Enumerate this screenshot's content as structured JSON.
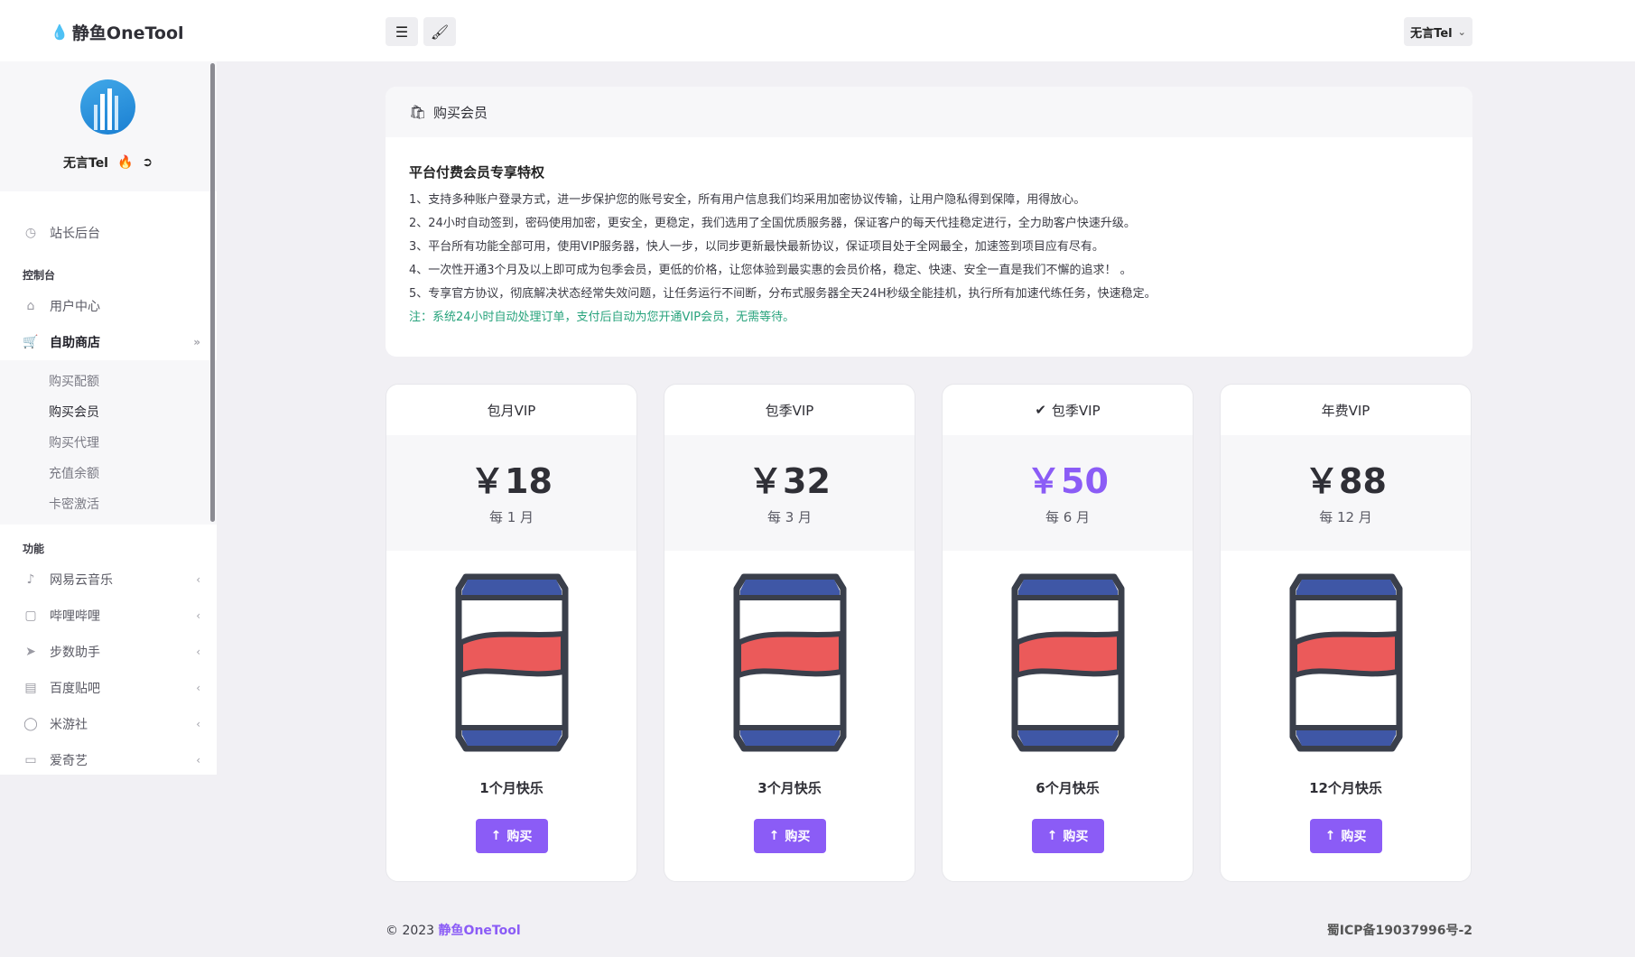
{
  "header": {
    "brand": "静鱼OneTool",
    "user_menu": "无言Tel",
    "menu_icon": "hamburger-icon",
    "theme_icon": "brush-icon"
  },
  "sidebar": {
    "profile_name": "无言Tel",
    "dashboard": "站长后台",
    "section_console": "控制台",
    "user_center": "用户中心",
    "shop": "自助商店",
    "shop_items": [
      "购买配额",
      "购买会员",
      "购买代理",
      "充值余额",
      "卡密激活"
    ],
    "section_functions": "功能",
    "functions": [
      "网易云音乐",
      "哔哩哔哩",
      "步数助手",
      "百度贴吧",
      "米游社",
      "爱奇艺"
    ]
  },
  "main": {
    "card_title": "购买会员",
    "privileges_title": "平台付费会员专享特权",
    "privileges": [
      "1、支持多种账户登录方式，进一步保护您的账号安全，所有用户信息我们均采用加密协议传输，让用户隐私得到保障，用得放心。",
      "2、24小时自动签到，密码使用加密，更安全，更稳定，我们选用了全国优质服务器，保证客户的每天代挂稳定进行，全力助客户快速升级。",
      "3、平台所有功能全部可用，使用VIP服务器，快人一步，以同步更新最快最新协议，保证项目处于全网最全，加速签到项目应有尽有。",
      "4、一次性开通3个月及以上即可成为包季会员，更低的价格，让您体验到最实惠的会员价格，稳定、快速、安全一直是我们不懈的追求！ 。",
      "5、专享官方协议，彻底解决状态经常失效问题，让任务运行不间断，分布式服务器全天24H秒级全能挂机，执行所有加速代练任务，快速稳定。"
    ],
    "note": "注：系统24小时自动处理订单，支付后自动为您开通VIP会员，无需等待。"
  },
  "plans": [
    {
      "title": "包月VIP",
      "price": "￥18",
      "period": "每 1 月",
      "name": "1个月快乐",
      "buy": "购买",
      "featured": false
    },
    {
      "title": "包季VIP",
      "price": "￥32",
      "period": "每 3 月",
      "name": "3个月快乐",
      "buy": "购买",
      "featured": false
    },
    {
      "title": "包季VIP",
      "price": "￥50",
      "period": "每 6 月",
      "name": "6个月快乐",
      "buy": "购买",
      "featured": true
    },
    {
      "title": "年费VIP",
      "price": "￥88",
      "period": "每 12 月",
      "name": "12个月快乐",
      "buy": "购买",
      "featured": false
    }
  ],
  "footer": {
    "copyright": "© 2023",
    "brand": "静鱼OneTool",
    "icp": "蜀ICP备19037996号-2"
  },
  "colors": {
    "accent": "#8b5cf6",
    "note": "#27a37c",
    "can_red": "#eb5a5a",
    "can_blue": "#3f57a6"
  }
}
